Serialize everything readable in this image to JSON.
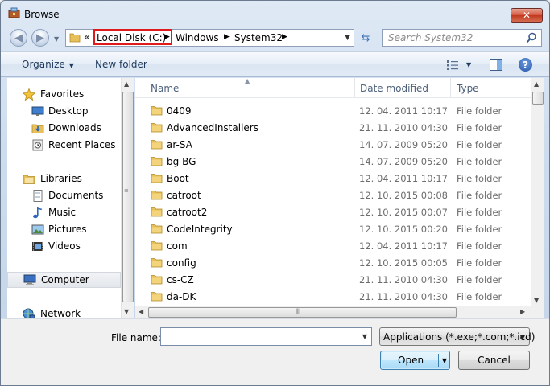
{
  "window": {
    "title": "Browse",
    "close_label": "✕"
  },
  "navigation": {
    "overflow": "«",
    "breadcrumbs": [
      "Local Disk (C:)",
      "Windows",
      "System32"
    ],
    "search_placeholder": "Search System32"
  },
  "toolbar": {
    "organize": "Organize",
    "new_folder": "New folder",
    "help": "?"
  },
  "sidebar": {
    "items": [
      {
        "label": "Favorites",
        "icon": "star-icon"
      },
      {
        "label": "Desktop",
        "icon": "desktop-icon"
      },
      {
        "label": "Downloads",
        "icon": "downloads-icon"
      },
      {
        "label": "Recent Places",
        "icon": "recent-places-icon"
      },
      {
        "label": "Libraries",
        "icon": "libraries-icon"
      },
      {
        "label": "Documents",
        "icon": "documents-icon"
      },
      {
        "label": "Music",
        "icon": "music-icon"
      },
      {
        "label": "Pictures",
        "icon": "pictures-icon"
      },
      {
        "label": "Videos",
        "icon": "videos-icon"
      },
      {
        "label": "Computer",
        "icon": "computer-icon",
        "selected": true
      },
      {
        "label": "Network",
        "icon": "network-icon"
      }
    ]
  },
  "file_list": {
    "columns": {
      "name": "Name",
      "date": "Date modified",
      "type": "Type"
    },
    "rows": [
      {
        "name": "0409",
        "date": "12. 04. 2011 10:17",
        "type": "File folder"
      },
      {
        "name": "AdvancedInstallers",
        "date": "21. 11. 2010 04:30",
        "type": "File folder"
      },
      {
        "name": "ar-SA",
        "date": "14. 07. 2009 05:20",
        "type": "File folder"
      },
      {
        "name": "bg-BG",
        "date": "14. 07. 2009 05:20",
        "type": "File folder"
      },
      {
        "name": "Boot",
        "date": "12. 04. 2011 10:17",
        "type": "File folder"
      },
      {
        "name": "catroot",
        "date": "12. 10. 2015 00:08",
        "type": "File folder"
      },
      {
        "name": "catroot2",
        "date": "12. 10. 2015 00:07",
        "type": "File folder"
      },
      {
        "name": "CodeIntegrity",
        "date": "12. 10. 2015 00:20",
        "type": "File folder"
      },
      {
        "name": "com",
        "date": "12. 04. 2011 10:17",
        "type": "File folder"
      },
      {
        "name": "config",
        "date": "12. 10. 2015 00:05",
        "type": "File folder"
      },
      {
        "name": "cs-CZ",
        "date": "21. 11. 2010 04:30",
        "type": "File folder"
      },
      {
        "name": "da-DK",
        "date": "21. 11. 2010 04:30",
        "type": "File folder"
      }
    ]
  },
  "bottom": {
    "file_name_label": "File name:",
    "file_name_value": "",
    "filter_label": "Applications (*.exe;*.com;*.icd)",
    "open_label": "Open",
    "cancel_label": "Cancel"
  },
  "colors": {
    "highlight_box": "#e01a1a",
    "folder": "#e8c05a",
    "accent": "#3c7fb1"
  }
}
